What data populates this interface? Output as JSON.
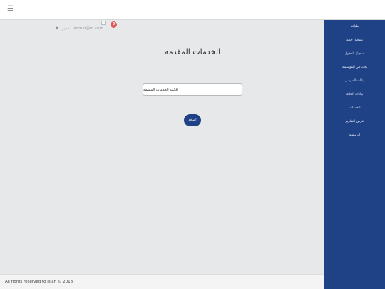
{
  "topbar": {
    "menu_icon": "hamburger-icon"
  },
  "userbar": {
    "email": "admin@m.com",
    "role": "مدير",
    "notification_count": "9"
  },
  "page": {
    "title": "الخدمات المقدمه"
  },
  "form": {
    "select_value": "قائمه الخدمات المقدمه",
    "add_label": "اضافه"
  },
  "footer": {
    "text": "All rights reserved to Islah © 2018"
  },
  "sidebar": {
    "items": [
      {
        "label": "طباعة"
      },
      {
        "label": "تسجيل جديد"
      },
      {
        "label": "تسجيل الدخول"
      },
      {
        "label": "بحث في المؤسسه"
      },
      {
        "label": "بيانات المرضى"
      },
      {
        "label": "بيانات الحاله"
      },
      {
        "label": "الخدمات"
      },
      {
        "label": "عرض التقارير"
      },
      {
        "label": "الرئيسيه"
      }
    ]
  },
  "colors": {
    "sidebar_bg": "#1f4287",
    "badge": "#e05a5a",
    "content_bg": "#e7e8e9"
  }
}
